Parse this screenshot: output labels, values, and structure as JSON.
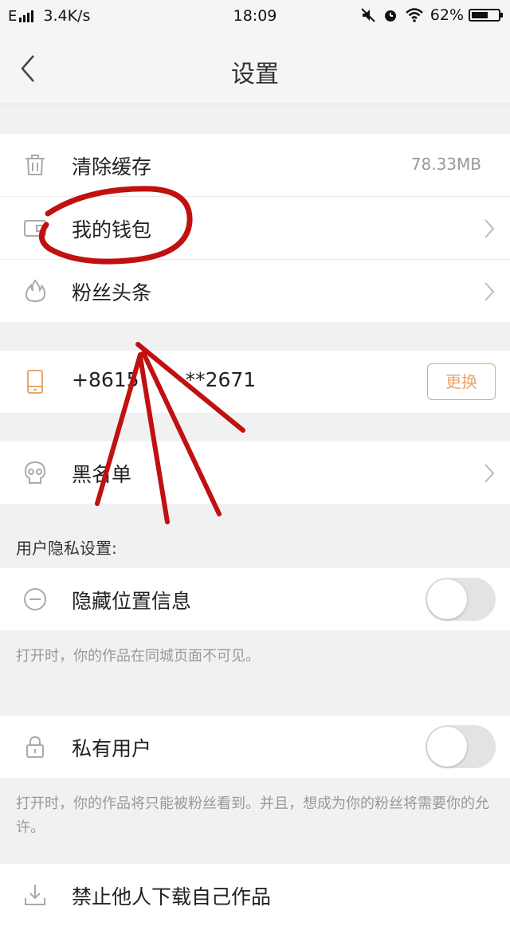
{
  "status_bar": {
    "network": "E",
    "speed": "3.4K/s",
    "time": "18:09",
    "battery": "62%",
    "battery_level": 0.62
  },
  "header": {
    "title": "设置",
    "back_icon": "chevron-left-icon"
  },
  "items": {
    "clear_cache": {
      "label": "清除缓存",
      "value": "78.33MB",
      "icon": "trash-icon"
    },
    "wallet": {
      "label": "我的钱包",
      "icon": "wallet-icon"
    },
    "fans_headline": {
      "label": "粉丝头条",
      "icon": "flame-icon"
    },
    "phone": {
      "label": "+8615",
      "masked": "**2671",
      "button": "更换",
      "icon": "phone-icon"
    },
    "blacklist": {
      "label": "黑名单",
      "icon": "skull-icon"
    }
  },
  "privacy": {
    "section_label": "用户隐私设置:",
    "hide_location": {
      "label": "隐藏位置信息",
      "hint": "打开时，你的作品在同城页面不可见。",
      "on": false,
      "icon": "minus-circle-icon"
    },
    "private_user": {
      "label": "私有用户",
      "hint": "打开时，你的作品将只能被粉丝看到。并且，想成为你的粉丝将需要你的允许。",
      "on": false,
      "icon": "lock-icon"
    },
    "no_download": {
      "label": "禁止他人下载自己作品",
      "icon": "download-icon"
    }
  },
  "colors": {
    "accent": "#e8a76d",
    "annotation": "#c01010"
  }
}
